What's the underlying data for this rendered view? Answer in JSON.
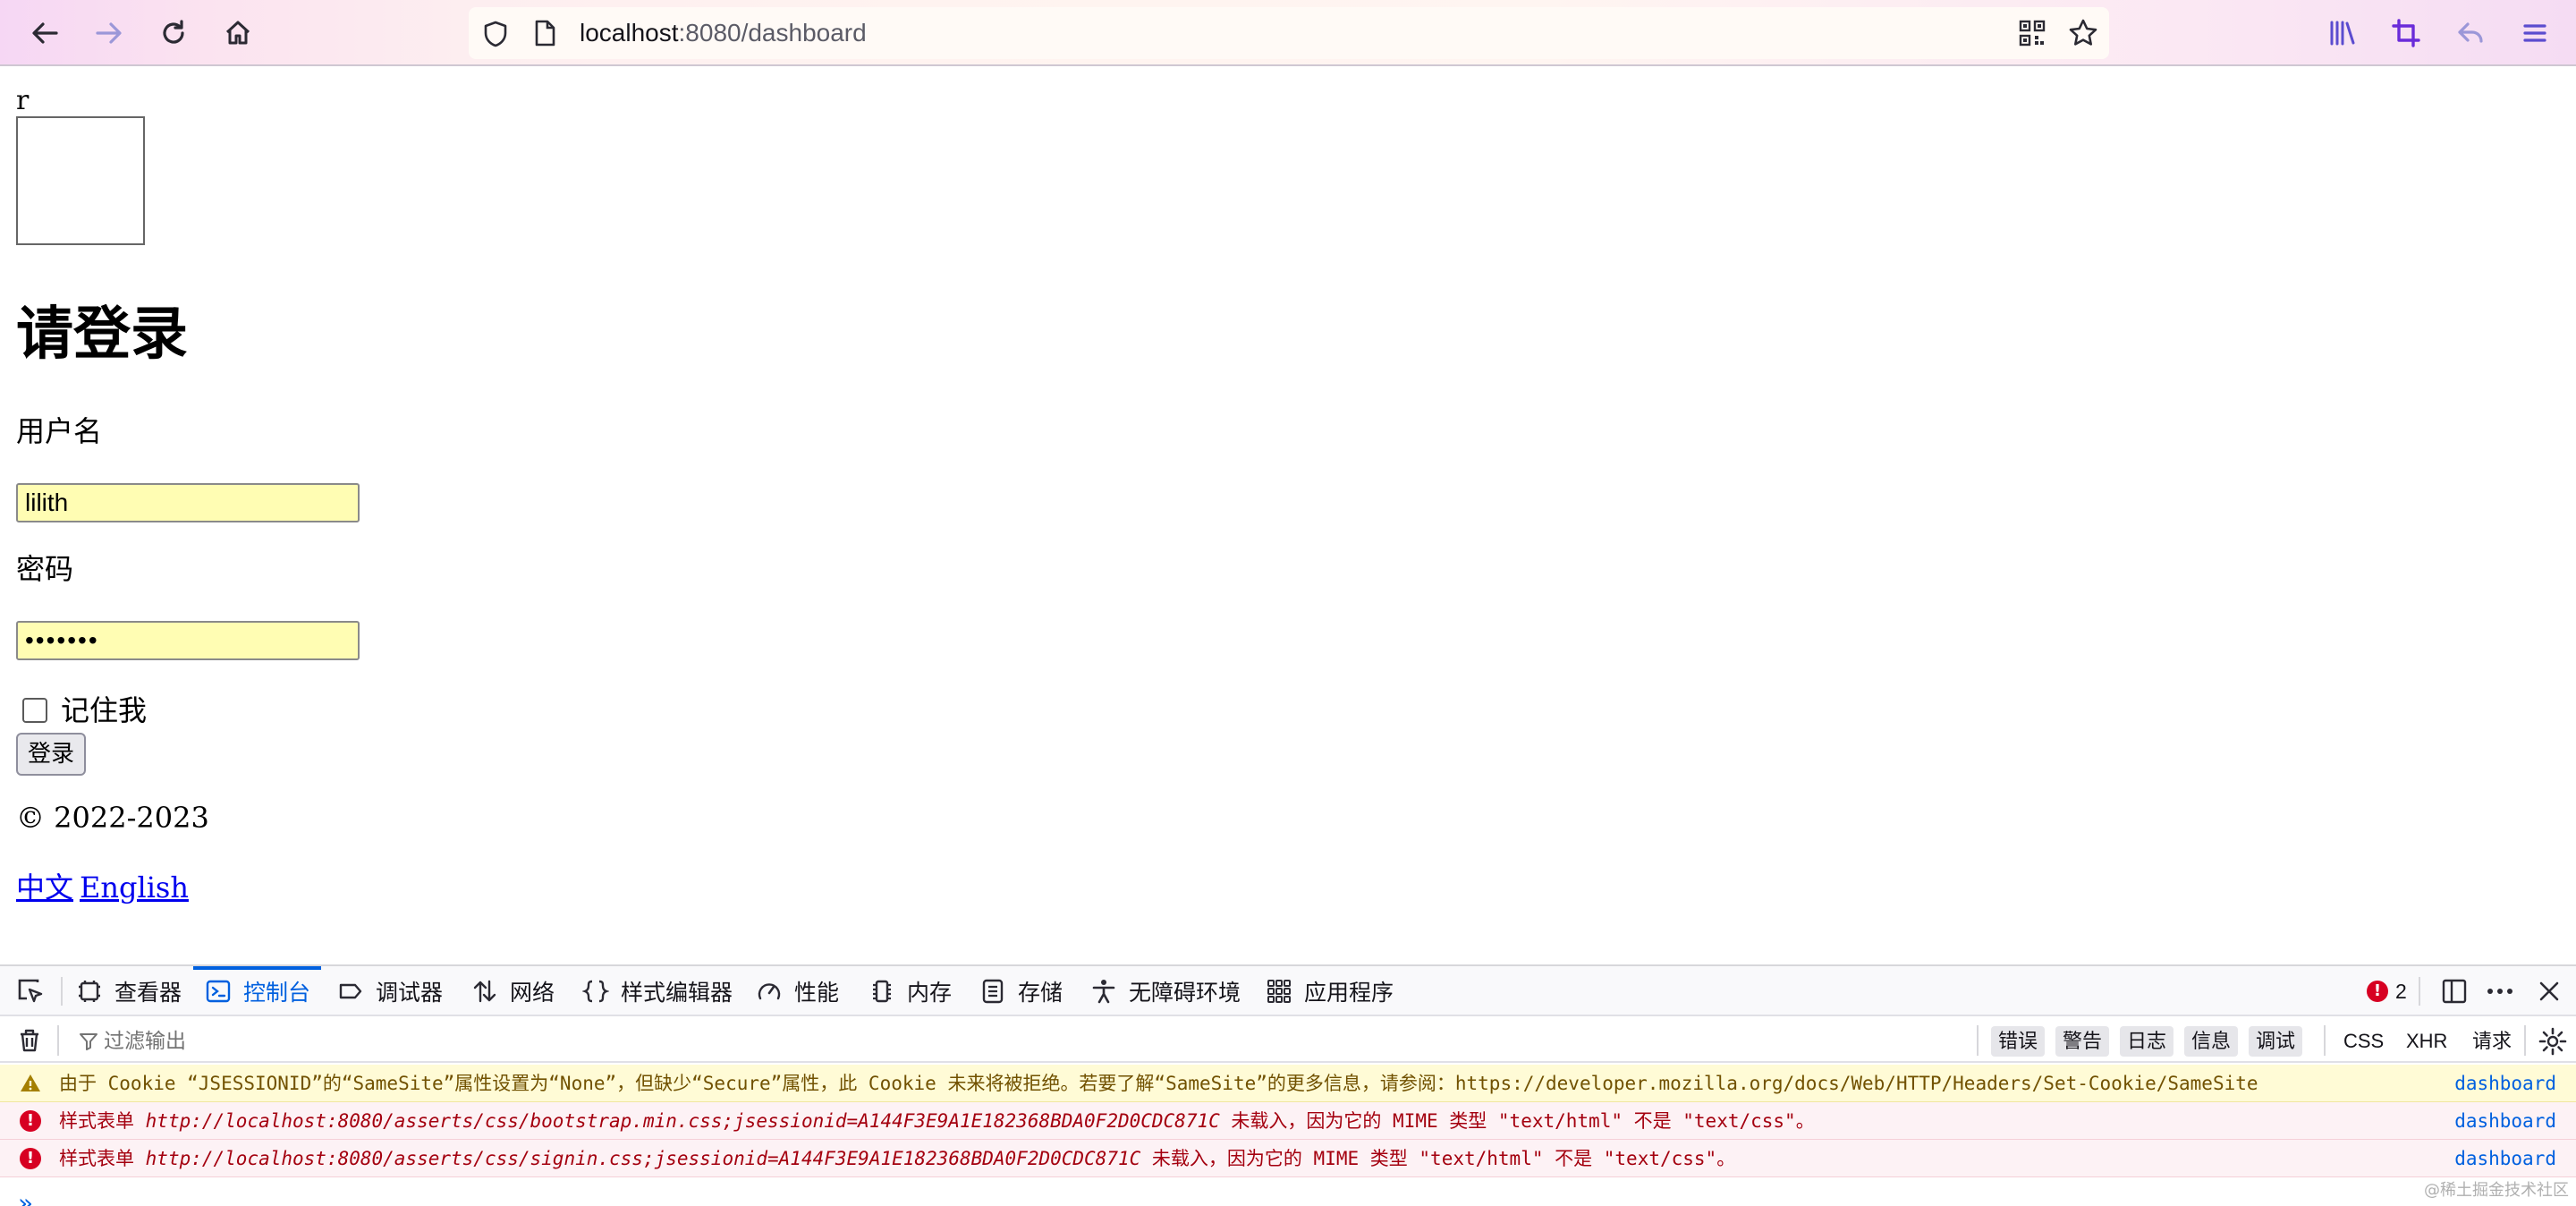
{
  "browser": {
    "url_host": "localhost",
    "url_path": ":8080/dashboard"
  },
  "page": {
    "logo_alt": "r",
    "heading": "请登录",
    "username_label": "用户名",
    "username_value": "lilith",
    "password_label": "密码",
    "password_value": "•••••••",
    "remember_label": "记住我",
    "login_button": "登录",
    "copyright": "© 2022-2023",
    "lang_zh": "中文",
    "lang_en": "English"
  },
  "devtools": {
    "tabs": [
      {
        "label": "查看器",
        "icon": "inspector-icon"
      },
      {
        "label": "控制台",
        "icon": "console-icon",
        "selected": true
      },
      {
        "label": "调试器",
        "icon": "debugger-icon"
      },
      {
        "label": "网络",
        "icon": "network-icon"
      },
      {
        "label": "样式编辑器",
        "icon": "style-editor-icon"
      },
      {
        "label": "性能",
        "icon": "performance-icon"
      },
      {
        "label": "内存",
        "icon": "memory-icon"
      },
      {
        "label": "存储",
        "icon": "storage-icon"
      },
      {
        "label": "无障碍环境",
        "icon": "accessibility-icon"
      },
      {
        "label": "应用程序",
        "icon": "application-icon"
      }
    ],
    "error_count": "2",
    "filter_placeholder": "过滤输出",
    "levels": [
      "错误",
      "警告",
      "日志",
      "信息",
      "调试"
    ],
    "extra_filters": [
      "CSS",
      "XHR",
      "请求"
    ],
    "messages": [
      {
        "level": "warning",
        "text": "由于 Cookie “JSESSIONID”的“SameSite”属性设置为“None”，但缺少“Secure”属性，此 Cookie 未来将被拒绝。若要了解“SameSite”的更多信息，请参阅：https://developer.mozilla.org/docs/Web/HTTP/Headers/Set-Cookie/SameSite",
        "source": "dashboard"
      },
      {
        "level": "error",
        "prefix": "样式表单",
        "url": "http://localhost:8080/asserts/css/bootstrap.min.css;jsessionid=A144F3E9A1E182368BDA0F2D0CDC871C",
        "suffix": "未载入，因为它的 MIME 类型 \"text/html\" 不是 \"text/css\"。",
        "source": "dashboard"
      },
      {
        "level": "error",
        "prefix": "样式表单",
        "url": "http://localhost:8080/asserts/css/signin.css;jsessionid=A144F3E9A1E182368BDA0F2D0CDC871C",
        "suffix": "未载入，因为它的 MIME 类型 \"text/html\" 不是 \"text/css\"。",
        "source": "dashboard"
      }
    ],
    "prompt": "»"
  },
  "watermark": "@稀土掘金技术社区",
  "colors": {
    "accent": "#0060df",
    "autofill": "#fffdb3",
    "warning_bg": "#fffbd6",
    "error_bg": "#fdf2f5",
    "error_red": "#d70022"
  }
}
